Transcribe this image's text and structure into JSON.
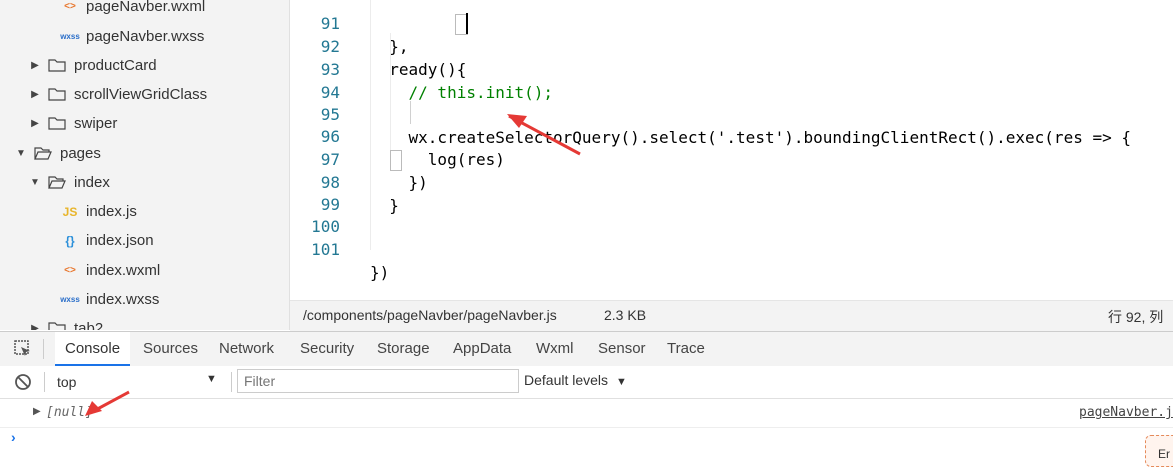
{
  "sidebar": {
    "items": [
      {
        "label": "pageNavber.wxml",
        "icon": "<>"
      },
      {
        "label": "pageNavber.wxss",
        "icon": "wxss"
      },
      {
        "label": "productCard"
      },
      {
        "label": "scrollViewGridClass"
      },
      {
        "label": "swiper"
      },
      {
        "label": "pages"
      },
      {
        "label": "index"
      },
      {
        "label": "index.js",
        "icon": "JS"
      },
      {
        "label": "index.json",
        "icon": "{}"
      },
      {
        "label": "index.wxml",
        "icon": "<>"
      },
      {
        "label": "index.wxss",
        "icon": "wxss"
      },
      {
        "label": "tab2"
      }
    ]
  },
  "editor": {
    "lines": [
      {
        "num": "91",
        "code": "  },"
      },
      {
        "num": "92",
        "code": "  ready(){"
      },
      {
        "num": "93",
        "code": "    // this.init();"
      },
      {
        "num": "94",
        "code": ""
      },
      {
        "num": "95",
        "code": "    wx.createSelectorQuery().select('.test').boundingClientRect().exec(res => {"
      },
      {
        "num": "96",
        "code": "      log(res)"
      },
      {
        "num": "97",
        "code": "    })"
      },
      {
        "num": "98",
        "code": "  }"
      },
      {
        "num": "99",
        "code": ""
      },
      {
        "num": "100",
        "code": ""
      },
      {
        "num": "101",
        "code": "})"
      }
    ]
  },
  "status": {
    "path": "/components/pageNavber/pageNavber.js",
    "size": "2.3 KB",
    "position": "行 92, 列"
  },
  "devtools": {
    "tabs": [
      "Console",
      "Sources",
      "Network",
      "Security",
      "Storage",
      "AppData",
      "Wxml",
      "Sensor",
      "Trace"
    ],
    "context": "top",
    "filter_placeholder": "Filter",
    "levels": "Default levels"
  },
  "console": {
    "output": "[null]",
    "source": "pageNavber.j",
    "badge": "Er"
  },
  "colors": {
    "accent": "#1a73e8",
    "arrow": "#e53935"
  }
}
